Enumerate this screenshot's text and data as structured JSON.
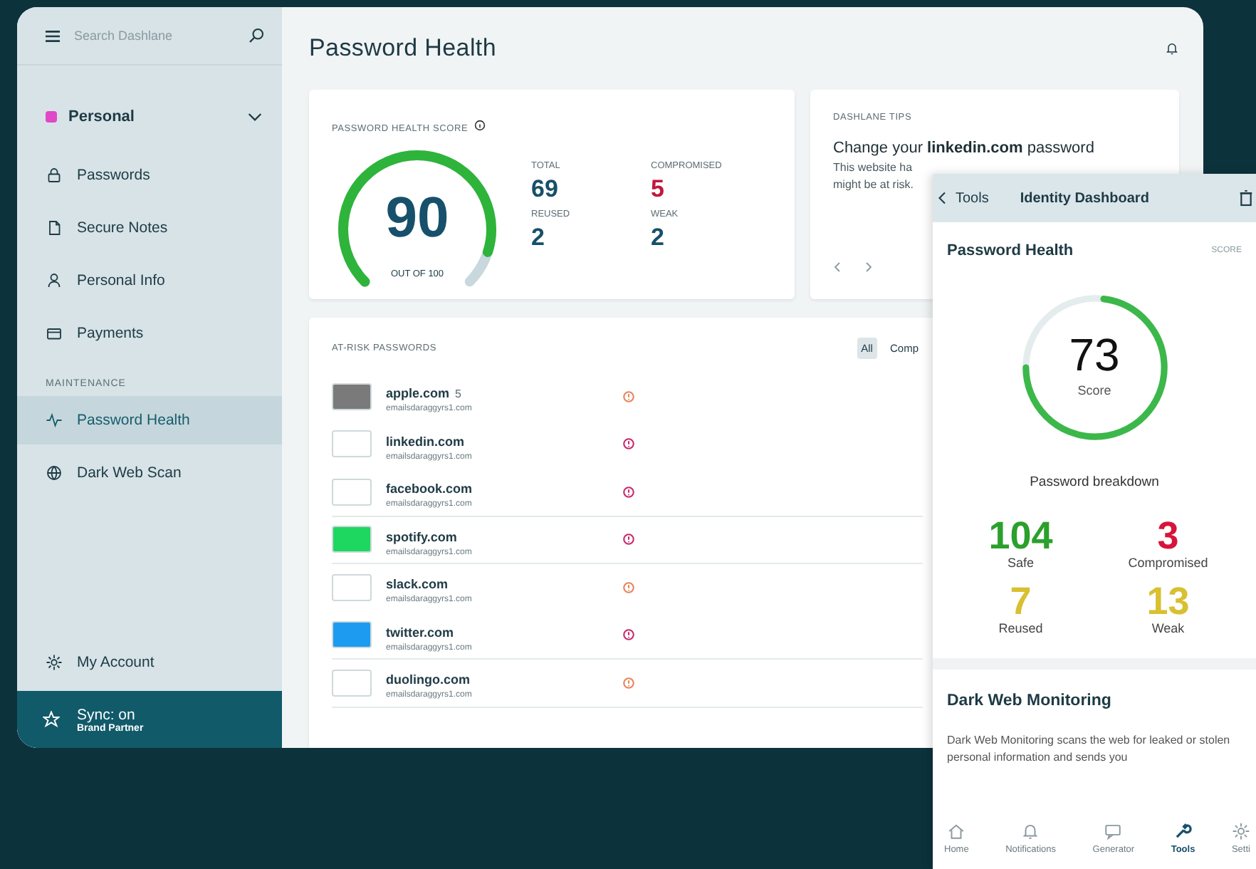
{
  "sidebar": {
    "search": {
      "placeholder": "Search Dashlane"
    },
    "space": {
      "label": "Personal",
      "color": "#e048c8"
    },
    "items": [
      {
        "label": "Passwords",
        "selected": false
      },
      {
        "label": "Secure Notes",
        "selected": false
      },
      {
        "label": "Personal Info",
        "selected": false
      },
      {
        "label": "Payments",
        "selected": false
      }
    ],
    "section_label": "MAINTENANCE",
    "maintenance_items": [
      {
        "label": "Password Health",
        "selected": true
      },
      {
        "label": "Dark Web Scan",
        "selected": false
      }
    ],
    "account_item": {
      "label": "My Account",
      "selected": false
    },
    "sync": {
      "title": "Sync: on",
      "subtitle": "Brand Partner"
    }
  },
  "header": {
    "title": "Password Health"
  },
  "score_card": {
    "label": "PASSWORD HEALTH SCORE",
    "score": "90",
    "level": 0.9,
    "caption": "OUT OF 100",
    "stats": [
      {
        "label": "TOTAL",
        "value": "69",
        "color": "#17506a"
      },
      {
        "label": "COMPROMISED",
        "value": "5",
        "color": "#c0183c"
      },
      {
        "label": "REUSED",
        "value": "2",
        "color": "#17506a"
      },
      {
        "label": "WEAK",
        "value": "2",
        "color": "#17506a"
      }
    ]
  },
  "tips_card": {
    "label": "DASHLANE TIPS",
    "title": "Change your **linkedin.com** password",
    "lines": [
      "This website ha",
      "might be at risk."
    ]
  },
  "at_risk": {
    "title": "AT-RISK PASSWORDS",
    "filters": [
      {
        "label": "All",
        "selected": true
      },
      {
        "label": "Comp",
        "selected": false
      }
    ],
    "rows": [
      {
        "site": "apple.com",
        "badge": "5",
        "email": "emailsdaraggyrs1.com",
        "logo": {
          "color": "#7a7a7a"
        },
        "color": "#e8835a"
      },
      {
        "site": "linkedin.com",
        "email": "emailsdaraggyrs1.com",
        "logo": {
          "color": "#ffffff"
        },
        "color": "#c8286e"
      },
      {
        "site": "facebook.com",
        "email": "emailsdaraggyrs1.com",
        "logo": {
          "color": "#ffffff"
        },
        "color": "#c8286e"
      },
      {
        "site": "spotify.com",
        "email": "emailsdaraggyrs1.com",
        "logo": {
          "color": "#1ed760"
        },
        "color": "#c8286e"
      },
      {
        "site": "slack.com",
        "email": "emailsdaraggyrs1.com",
        "logo": {
          "color": "#ffffff"
        },
        "color": "#e8835a"
      },
      {
        "site": "twitter.com",
        "email": "emailsdaraggyrs1.com",
        "logo": {
          "color": "#1d9bf0"
        },
        "color": "#c8286e"
      },
      {
        "site": "duolingo.com",
        "email": "emailsdaraggyrs1.com",
        "logo": {
          "color": "#ffffff"
        },
        "color": "#e8835a"
      }
    ]
  },
  "mobile": {
    "back": "Tools",
    "title": "Identity Dashboard",
    "section_title": "Password Health",
    "section_link": "SCORE",
    "score": "73",
    "level": 0.73,
    "score_label": "Score",
    "breakdown_title": "Password breakdown",
    "stats": [
      {
        "value": "104",
        "label": "Safe",
        "color": "#2ca02c"
      },
      {
        "value": "3",
        "label": "Compromised",
        "color": "#d8143a"
      },
      {
        "value": "7",
        "label": "Reused",
        "color": "#d8c030"
      },
      {
        "value": "13",
        "label": "Weak",
        "color": "#d8c030"
      }
    ],
    "dark_web": {
      "title": "Dark Web Monitoring",
      "text": "Dark Web Monitoring scans the web for leaked or stolen personal information and sends you"
    },
    "tabs": [
      {
        "label": "Home",
        "selected": false
      },
      {
        "label": "Notifications",
        "selected": false
      },
      {
        "label": "Generator",
        "selected": false
      },
      {
        "label": "Tools",
        "selected": true
      },
      {
        "label": "Setti",
        "selected": false
      }
    ]
  }
}
